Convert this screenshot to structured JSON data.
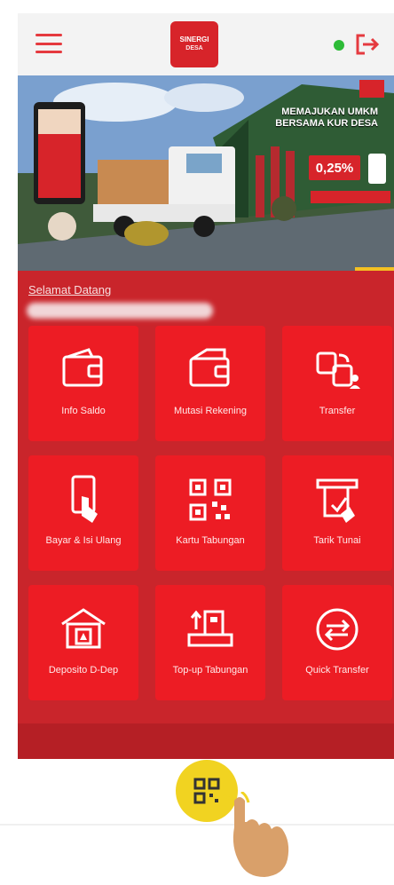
{
  "header": {
    "logo_line1": "SINERGI",
    "logo_line2": "DESA",
    "status_color": "#2dbb37"
  },
  "banner": {
    "headline": "MEMAJUKAN UMKM BERSAMA KUR DESA",
    "rate": "0,25%"
  },
  "greeting": {
    "label": "Selamat Datang"
  },
  "tiles": [
    {
      "label": "Info Saldo",
      "icon": "wallet-icon"
    },
    {
      "label": "Mutasi Rekening",
      "icon": "wallet-history-icon"
    },
    {
      "label": "Transfer",
      "icon": "transfer-icon"
    },
    {
      "label": "Bayar & Isi Ulang",
      "icon": "mobile-payment-icon"
    },
    {
      "label": "Kartu Tabungan",
      "icon": "qr-code-icon"
    },
    {
      "label": "Tarik Tunai",
      "icon": "cash-withdrawal-icon"
    },
    {
      "label": "Deposito D-Dep",
      "icon": "deposit-vault-icon"
    },
    {
      "label": "Top-up Tabungan",
      "icon": "topup-savings-icon"
    },
    {
      "label": "Quick Transfer",
      "icon": "quick-transfer-icon"
    }
  ],
  "colors": {
    "brand_red": "#ed1c24",
    "background_red": "#c9252b",
    "scan_yellow": "#f1d321"
  },
  "bottom": {
    "scan_icon": "qr-scan-icon"
  }
}
